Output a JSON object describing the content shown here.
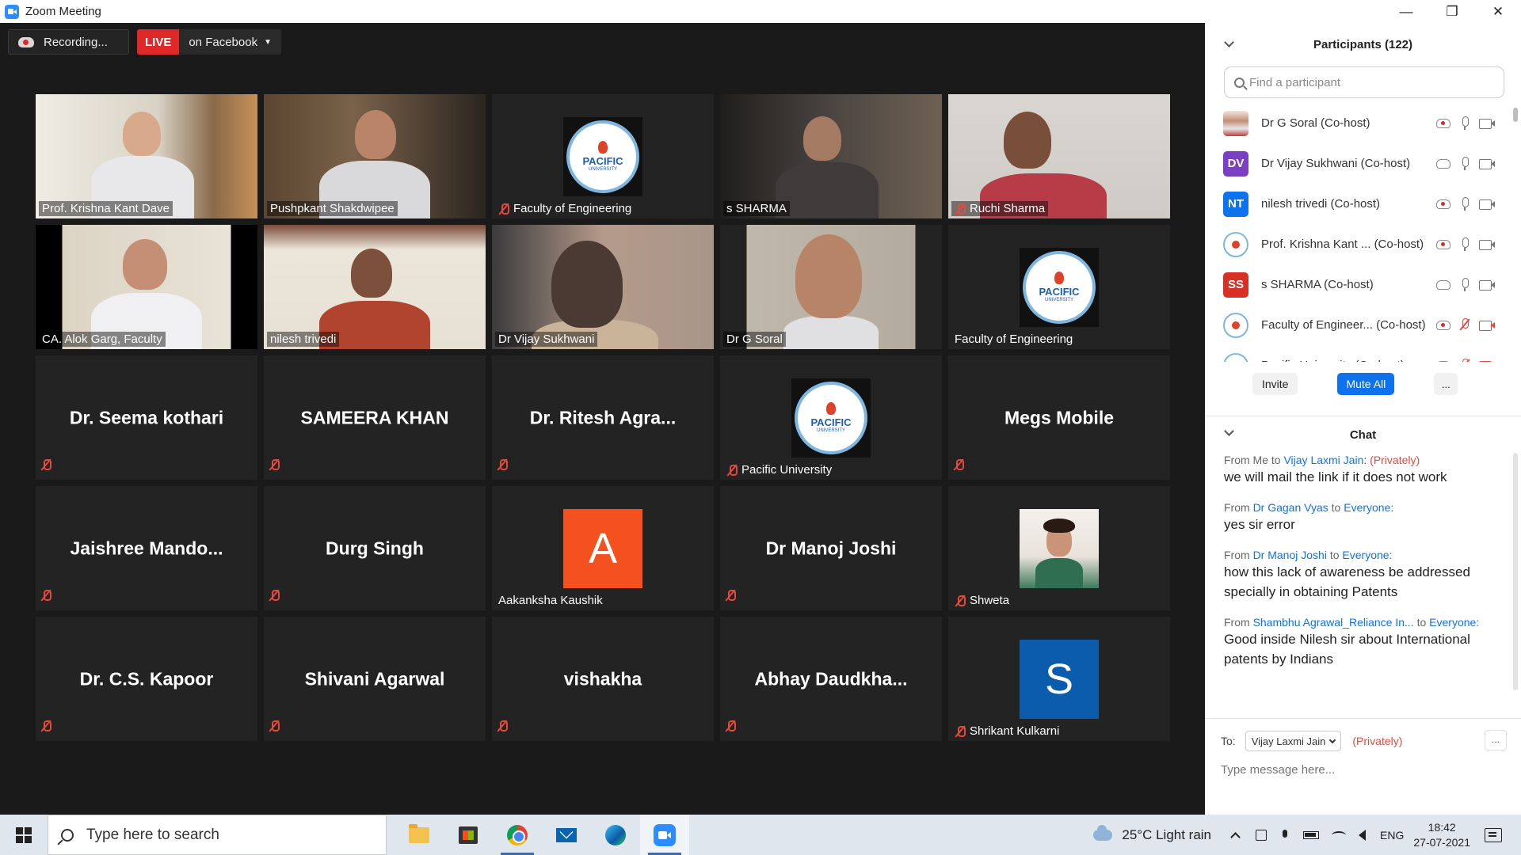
{
  "window": {
    "title": "Zoom Meeting",
    "minimize": "—",
    "restore": "❐",
    "close": "✕"
  },
  "recording": {
    "label": "Recording...",
    "live_tag": "LIVE",
    "live_destination": "on Facebook"
  },
  "tiles": [
    {
      "name": "Prof. Krishna Kant Dave",
      "type": "video",
      "muted": false
    },
    {
      "name": "Pushpkant Shakdwipee",
      "type": "video",
      "muted": false
    },
    {
      "name": "Faculty of Engineering",
      "type": "logo",
      "muted": true
    },
    {
      "name": "s SHARMA",
      "type": "video",
      "muted": false
    },
    {
      "name": "Ruchi Sharma",
      "type": "video",
      "muted": true
    },
    {
      "name": "CA. Alok Garg, Faculty",
      "type": "video",
      "muted": false,
      "active_speaker": true
    },
    {
      "name": "nilesh trivedi",
      "type": "video",
      "muted": false
    },
    {
      "name": "Dr Vijay Sukhwani",
      "type": "video",
      "muted": false
    },
    {
      "name": "Dr G Soral",
      "type": "video",
      "muted": false
    },
    {
      "name": "Faculty of Engineering",
      "type": "logo",
      "muted": false
    },
    {
      "name": "Dr. Seema kothari",
      "type": "name",
      "muted": true
    },
    {
      "name": "SAMEERA KHAN",
      "type": "name",
      "muted": true
    },
    {
      "name": "Dr.  Ritesh  Agra...",
      "type": "name",
      "muted": true
    },
    {
      "name": "Pacific University",
      "type": "logo",
      "muted": true
    },
    {
      "name": "Megs Mobile",
      "type": "name",
      "muted": true
    },
    {
      "name": "Jaishree  Mando...",
      "type": "name",
      "muted": true
    },
    {
      "name": "Durg Singh",
      "type": "name",
      "muted": true
    },
    {
      "name": "Aakanksha Kaushik",
      "type": "avatar",
      "initial": "A",
      "color": "#f4511e",
      "muted": false
    },
    {
      "name": "Dr Manoj Joshi",
      "type": "name",
      "muted": true
    },
    {
      "name": "Shweta",
      "type": "photo",
      "muted": true
    },
    {
      "name": "Dr. C.S. Kapoor",
      "type": "name",
      "muted": true
    },
    {
      "name": "Shivani Agarwal",
      "type": "name",
      "muted": true
    },
    {
      "name": "vishakha",
      "type": "name",
      "muted": true
    },
    {
      "name": "Abhay  Daudkha...",
      "type": "name",
      "muted": true
    },
    {
      "name": "Shrikant Kulkarni",
      "type": "avatar",
      "initial": "S",
      "color": "#0b5cad",
      "muted": true
    }
  ],
  "logo": {
    "text": "PACIFIC",
    "sub": "UNIVERSITY"
  },
  "participants": {
    "title": "Participants (122)",
    "search_placeholder": "Find a participant",
    "list": [
      {
        "name": "Dr G Soral (Co-host)",
        "avatar_type": "photo",
        "rec_red": true,
        "mic_muted": false,
        "cam_muted": false
      },
      {
        "name": "Dr Vijay Sukhwani (Co-host)",
        "avatar_type": "initials",
        "initials": "DV",
        "color": "#7b3fc4",
        "rec_red": false,
        "mic_muted": false,
        "cam_muted": false
      },
      {
        "name": "nilesh trivedi (Co-host)",
        "avatar_type": "initials",
        "initials": "NT",
        "color": "#0e72ed",
        "rec_red": true,
        "mic_muted": false,
        "cam_muted": false
      },
      {
        "name": "Prof. Krishna Kant ...  (Co-host)",
        "avatar_type": "logo",
        "rec_red": true,
        "mic_muted": false,
        "cam_muted": false
      },
      {
        "name": "s SHARMA (Co-host)",
        "avatar_type": "initials",
        "initials": "SS",
        "color": "#d93025",
        "rec_red": false,
        "mic_muted": false,
        "cam_muted": false
      },
      {
        "name": "Faculty of Engineer...  (Co-host)",
        "avatar_type": "logo",
        "rec_red": true,
        "mic_muted": true,
        "cam_muted": true
      },
      {
        "name": "Pacific University (Co-host)",
        "avatar_type": "logo",
        "rec_red": true,
        "mic_muted": true,
        "cam_muted": true
      }
    ],
    "invite": "Invite",
    "mute_all": "Mute All",
    "more": "..."
  },
  "chat": {
    "title": "Chat",
    "messages": [
      {
        "from_prefix": "From Me to ",
        "who": "Vijay Laxmi Jain:",
        "suffix": " (Privately)",
        "suffix_private": true,
        "text": "we will mail the link if it does not work"
      },
      {
        "from_prefix": "From ",
        "who": "Dr Gagan Vyas",
        "mid": " to ",
        "to": "Everyone:",
        "text": "yes sir error"
      },
      {
        "from_prefix": "From ",
        "who": "Dr Manoj Joshi",
        "mid": " to ",
        "to": "Everyone:",
        "text": "how this lack of awareness be addressed\nspecially in obtaining Patents"
      },
      {
        "from_prefix": "From ",
        "who": "Shambhu Agrawal_Reliance In...",
        "mid": "   to ",
        "to": "Everyone:",
        "text": "Good inside Nilesh sir about International patents by Indians"
      }
    ],
    "to_label": "To:",
    "to_value": "Vijay Laxmi Jain",
    "to_private": "(Privately)",
    "more": "...",
    "input_placeholder": "Type message here..."
  },
  "taskbar": {
    "search_placeholder": "Type here to search",
    "weather": "25°C  Light rain",
    "lang": "ENG",
    "time": "18:42",
    "date": "27-07-2021"
  }
}
